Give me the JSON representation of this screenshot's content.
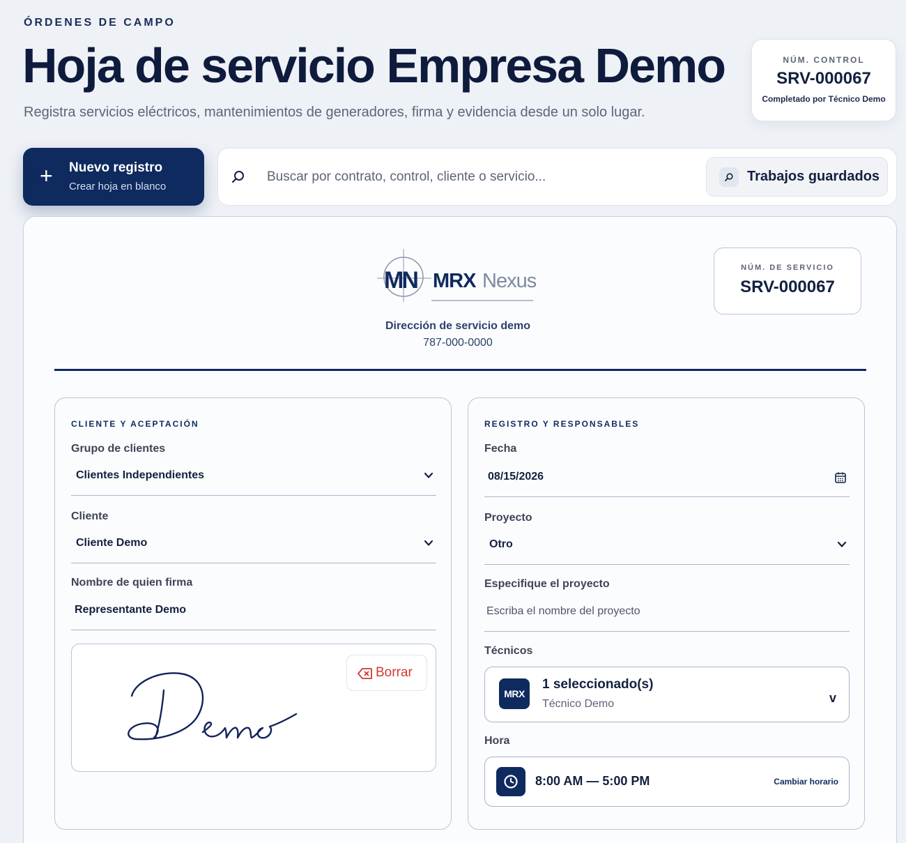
{
  "header": {
    "eyebrow": "ÓRDENES DE CAMPO",
    "title": "Hoja de servicio Empresa Demo",
    "subtitle": "Registra servicios eléctricos, mantenimientos de generadores, firma y evidencia desde un solo lugar."
  },
  "control": {
    "label": "NÚM. CONTROL",
    "value": "SRV-000067",
    "completed_by": "Completado por Técnico Demo"
  },
  "new_record": {
    "title": "Nuevo registro",
    "subtitle": "Crear hoja en blanco"
  },
  "search": {
    "placeholder": "Buscar por contrato, control, cliente o servicio...",
    "saved_label": "Trabajos guardados"
  },
  "sheet": {
    "logo_text": "MRX",
    "logo_text2": "Nexus",
    "address": "Dirección de servicio demo",
    "phone": "787-000-0000",
    "service_label": "NÚM. DE SERVICIO",
    "service_value": "SRV-000067"
  },
  "client_panel": {
    "title": "CLIENTE Y ACEPTACIÓN",
    "group_label": "Grupo de clientes",
    "group_value": "Clientes Independientes",
    "client_label": "Cliente",
    "client_value": "Cliente Demo",
    "signer_label": "Nombre de quien firma",
    "signer_value": "Representante Demo",
    "clear_label": "Borrar"
  },
  "record_panel": {
    "title": "REGISTRO Y RESPONSABLES",
    "date_label": "Fecha",
    "date_value": "08/15/2026",
    "project_label": "Proyecto",
    "project_value": "Otro",
    "specify_label": "Especifique el proyecto",
    "specify_placeholder": "Escriba el nombre del proyecto",
    "techs_label": "Técnicos",
    "techs_avatar": "MRX",
    "techs_selected": "1 seleccionado(s)",
    "techs_name": "Técnico Demo",
    "techs_chevron": "v",
    "time_label": "Hora",
    "time_value": "8:00 AM — 5:00 PM",
    "change_time": "Cambiar horario"
  },
  "colors": {
    "navy": "#0f2a5f",
    "background": "#eef1f6",
    "danger": "#d13a30"
  },
  "icons": [
    "plus-icon",
    "search-icon",
    "calendar-icon",
    "chevron-down-icon",
    "eraser-icon",
    "clock-icon"
  ]
}
